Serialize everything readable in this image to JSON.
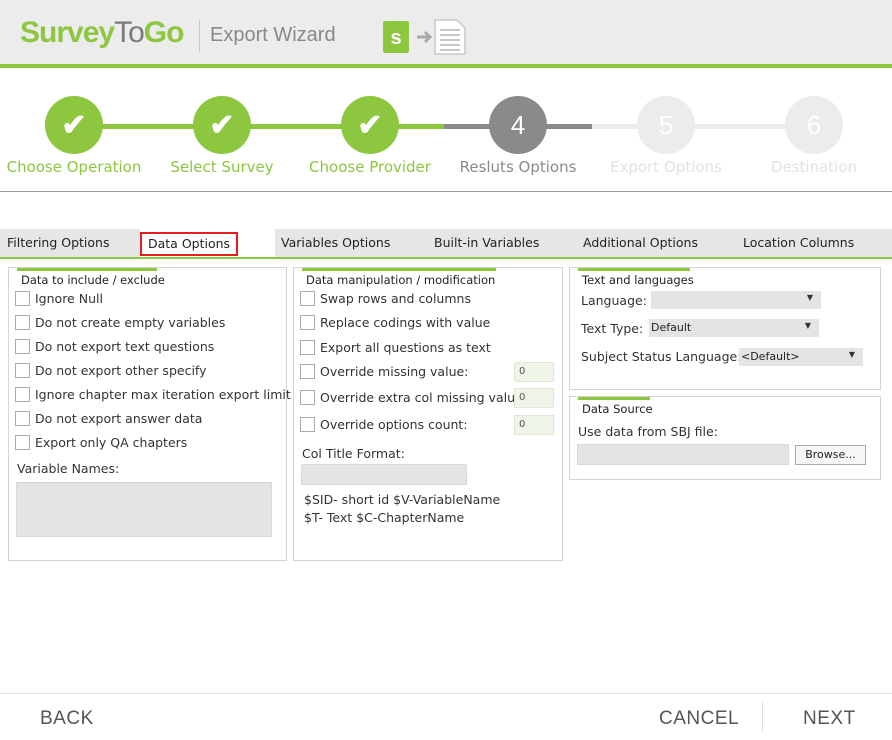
{
  "header": {
    "logo_part1": "Survey",
    "logo_part2": "To",
    "logo_part3": "Go",
    "title": "Export Wizard"
  },
  "stepper": {
    "steps": [
      {
        "number": "✔",
        "label": "Choose Operation",
        "state": "done"
      },
      {
        "number": "✔",
        "label": "Select Survey",
        "state": "done"
      },
      {
        "number": "✔",
        "label": "Choose Provider",
        "state": "done"
      },
      {
        "number": "4",
        "label": "Resluts Options",
        "state": "current"
      },
      {
        "number": "5",
        "label": "Export Options",
        "state": "future"
      },
      {
        "number": "6",
        "label": "Destination",
        "state": "future"
      }
    ]
  },
  "tabs": [
    {
      "label": "Filtering Options"
    },
    {
      "label": "Data Options"
    },
    {
      "label": "Variables Options"
    },
    {
      "label": "Built-in Variables"
    },
    {
      "label": "Additional Options"
    },
    {
      "label": "Location Columns"
    }
  ],
  "include_panel": {
    "title": "Data to include / exclude",
    "checkboxes": [
      "Ignore Null",
      "Do not create empty variables",
      "Do not export text questions",
      "Do not export other specify",
      "Ignore chapter max iteration export limit",
      "Do not export answer data",
      "Export only QA chapters"
    ],
    "variable_names_label": "Variable Names:"
  },
  "manip_panel": {
    "title": "Data manipulation / modification",
    "checkboxes": [
      "Swap rows and columns",
      "Replace codings with value",
      "Export all questions as text",
      "Override missing value:",
      "Override extra col missing value:",
      "Override options count:"
    ],
    "values": [
      "0",
      "0",
      "0"
    ],
    "col_title_format_label": "Col Title Format:",
    "hint_line1": "$SID- short id  $V-VariableName",
    "hint_line2": "$T- Text  $C-ChapterName"
  },
  "text_panel": {
    "title": "Text and languages",
    "language_label": "Language:",
    "language_value": "",
    "text_type_label": "Text Type:",
    "text_type_value": "Default",
    "subject_status_label": "Subject Status Language:",
    "subject_status_value": "<Default>"
  },
  "source_panel": {
    "title": "Data Source",
    "use_data_label": "Use data from SBJ file:",
    "browse_label": "Browse..."
  },
  "footer": {
    "back_label": "BACK",
    "cancel_label": "CANCEL",
    "next_label": "NEXT"
  },
  "colors": {
    "accent": "#8dc63f",
    "current_step": "#8a8a8a",
    "active_tab_outline": "#e41e1e"
  }
}
